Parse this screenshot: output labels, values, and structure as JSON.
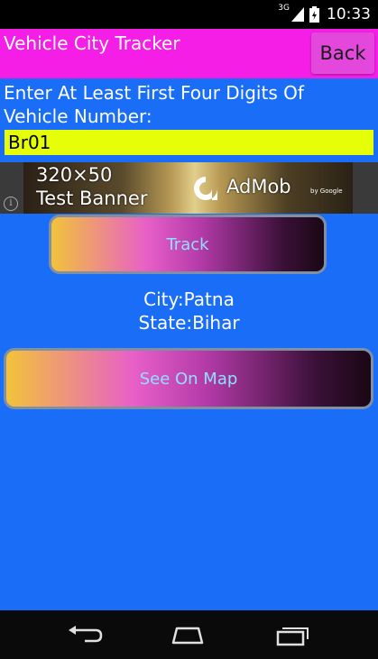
{
  "status_bar": {
    "network": "3G",
    "time": "10:33"
  },
  "app": {
    "title": "Vehicle City Tracker",
    "back_label": "Back",
    "prompt": "Enter At Least First Four Digits Of Vehicle Number:",
    "vehicle_number_value": "Br01",
    "ad": {
      "size_text": "320×50",
      "caption": "Test Banner",
      "brand": "AdMob",
      "byline": "by Google",
      "info_symbol": "i"
    },
    "track_label": "Track",
    "result": {
      "city": "City:Patna",
      "state": "State:Bihar"
    },
    "map_label": "See On Map"
  },
  "nav": {
    "icons": [
      "back-icon",
      "home-icon",
      "recent-apps-icon"
    ]
  },
  "colors": {
    "titlebar": "#f41ee6",
    "background": "#1a6df7",
    "input_background": "#e6ff08",
    "button_text": "#8fe0ff"
  }
}
